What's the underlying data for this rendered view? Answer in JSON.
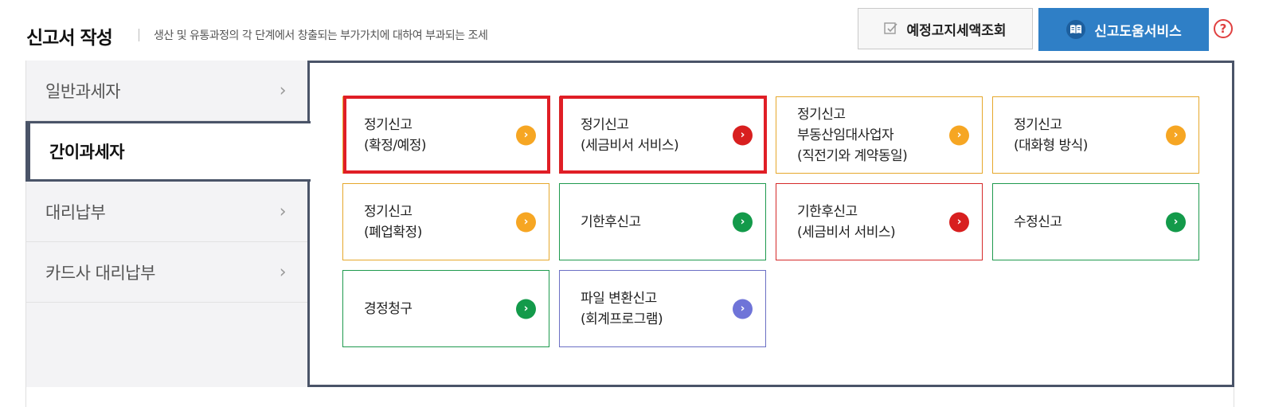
{
  "header": {
    "title": "신고서 작성",
    "description": "생산 및 유통과정의 각 단계에서 창출되는 부가가치에 대하여 부과되는 조세",
    "forecast_button": "예정고지세액조회",
    "help_button": "신고도움서비스",
    "help_icon_text": "?"
  },
  "sidebar": {
    "items": [
      {
        "label": "일반과세자",
        "chevron": "›"
      },
      {
        "label": "간이과세자",
        "active": true
      },
      {
        "label": "대리납부",
        "chevron": "›"
      },
      {
        "label": "카드사 대리납부",
        "chevron": "›"
      }
    ]
  },
  "cards": [
    {
      "label": "정기신고\n(확정/예정)",
      "color": "#e6a82c",
      "arrow_color": "#f6a623",
      "highlighted": true
    },
    {
      "label": "정기신고\n(세금비서 서비스)",
      "color": "#d52a2a",
      "arrow_color": "#d81f1f",
      "highlighted": true
    },
    {
      "label": "정기신고\n부동산임대사업자\n(직전기와 계약동일)",
      "color": "#e6a82c",
      "arrow_color": "#f6a623"
    },
    {
      "label": "정기신고\n(대화형 방식)",
      "color": "#e6a82c",
      "arrow_color": "#f6a623"
    },
    {
      "label": "정기신고\n(폐업확정)",
      "color": "#e6a82c",
      "arrow_color": "#f6a623"
    },
    {
      "label": "기한후신고",
      "color": "#1f9a4e",
      "arrow_color": "#139a4a"
    },
    {
      "label": "기한후신고\n(세금비서 서비스)",
      "color": "#d52a2a",
      "arrow_color": "#d81f1f"
    },
    {
      "label": "수정신고",
      "color": "#1f9a4e",
      "arrow_color": "#139a4a"
    },
    {
      "label": "경정청구",
      "color": "#1f9a4e",
      "arrow_color": "#139a4a"
    },
    {
      "label": "파일 변환신고\n(회계프로그램)",
      "color": "#6b6fc4",
      "arrow_color": "#6f74d8"
    }
  ],
  "arrow_glyph": "›"
}
